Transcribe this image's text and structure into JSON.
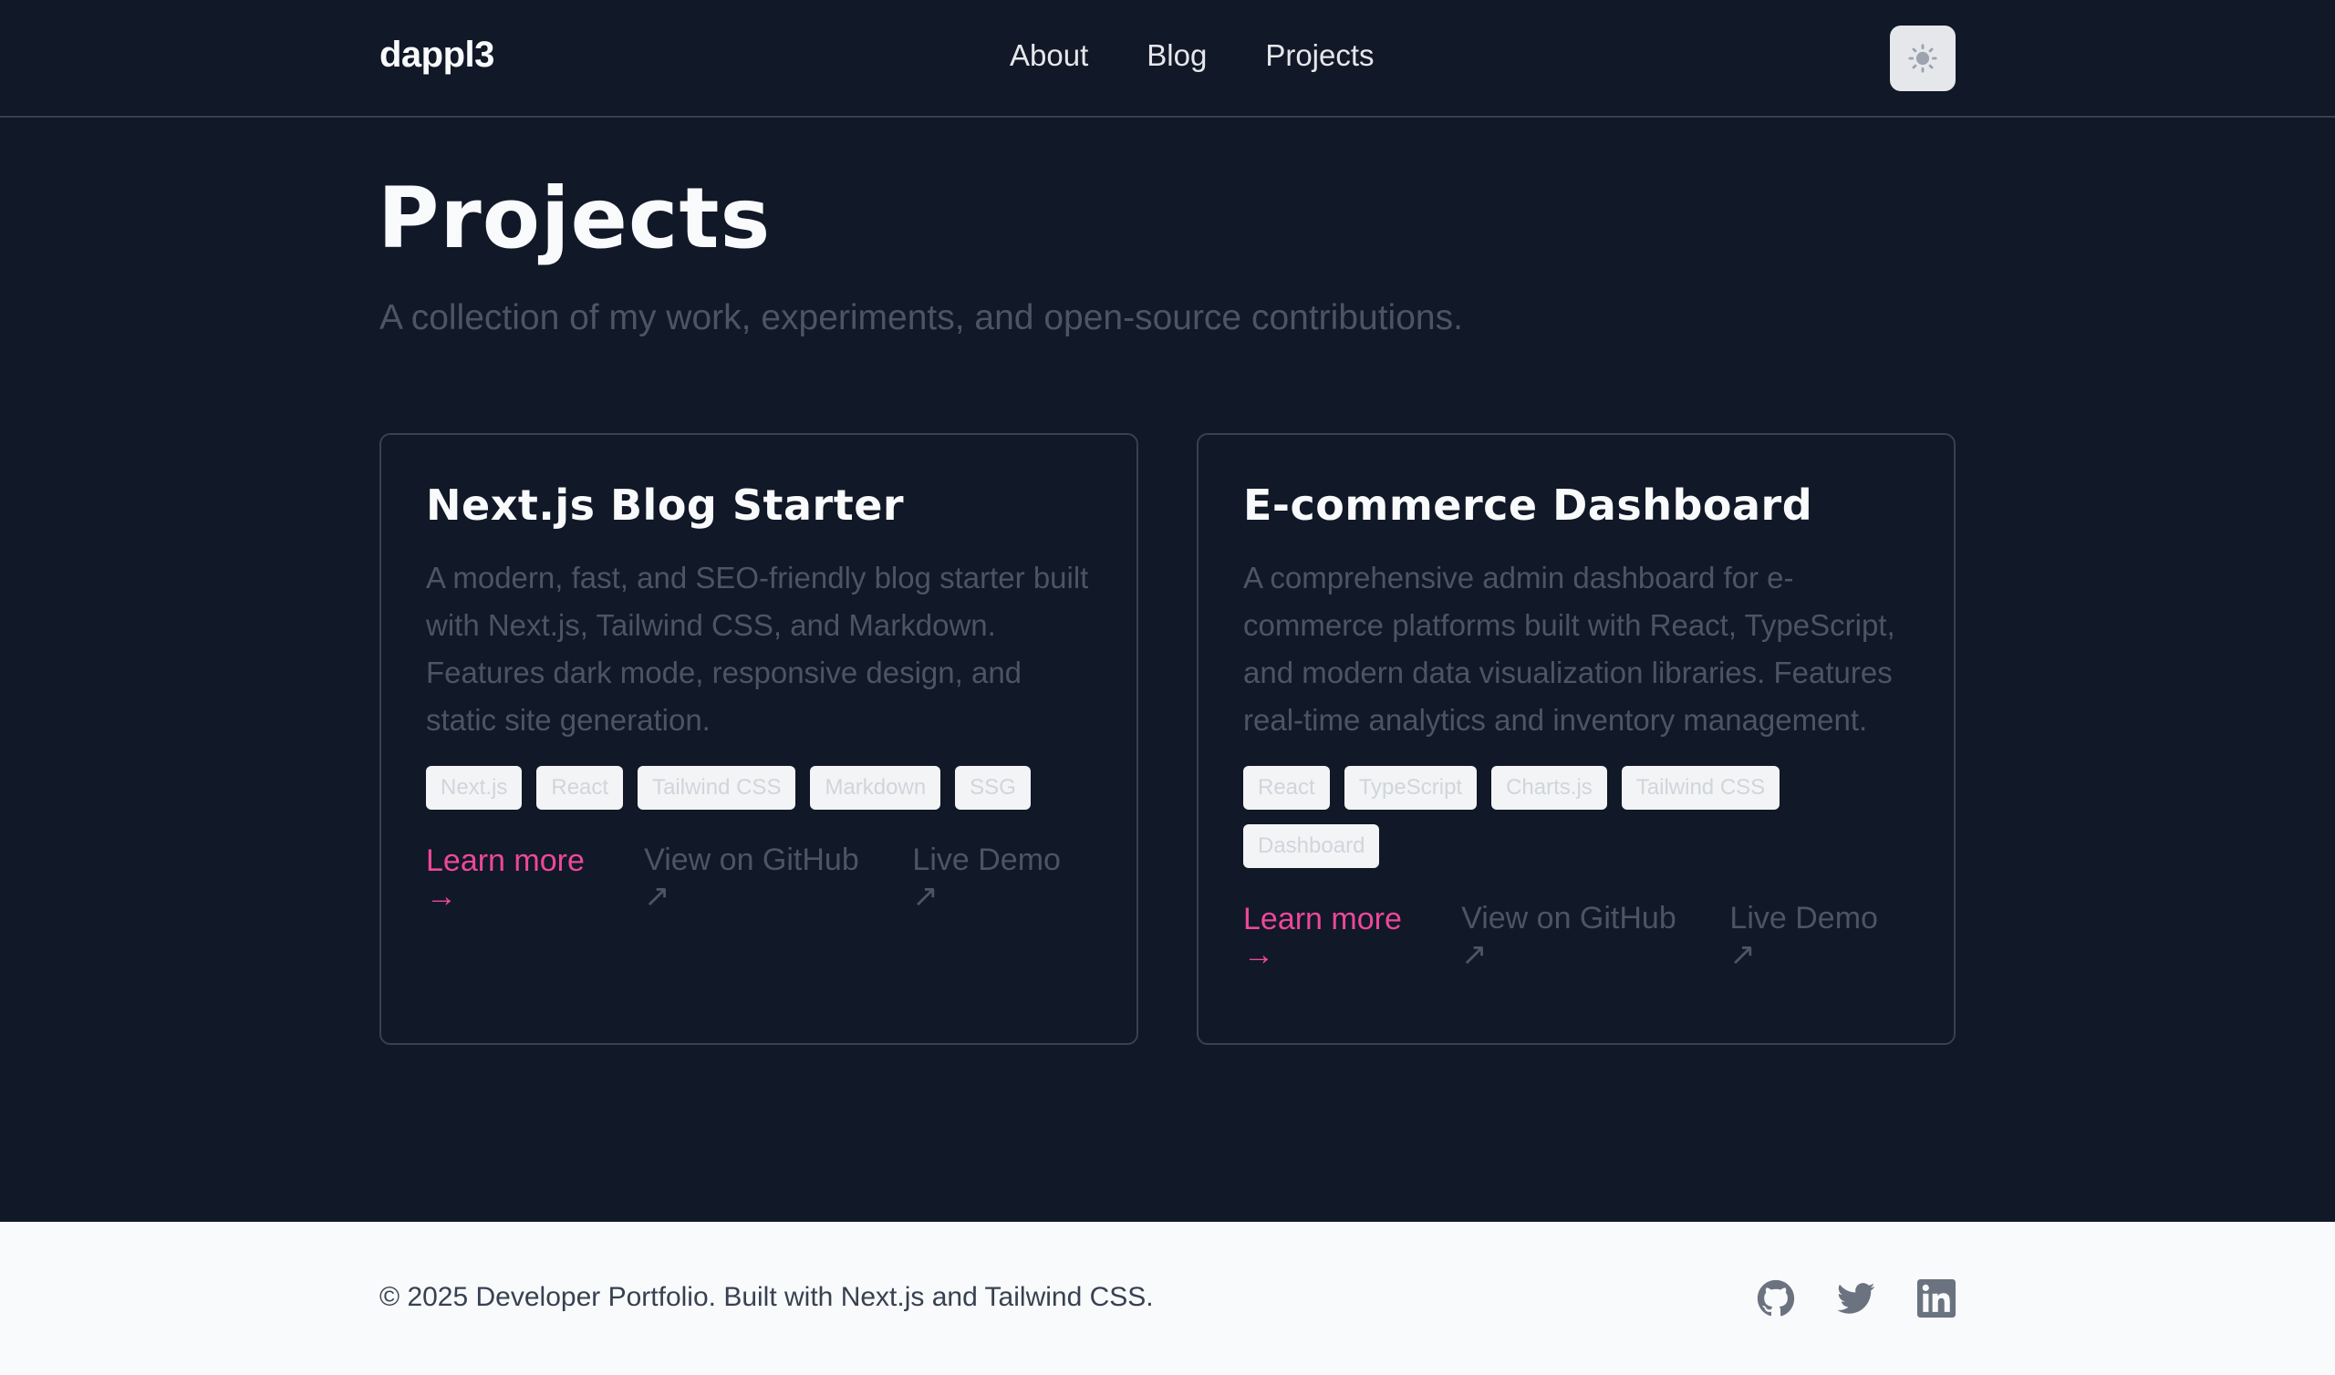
{
  "header": {
    "logo": "dappl3",
    "nav": [
      {
        "label": "About"
      },
      {
        "label": "Blog"
      },
      {
        "label": "Projects"
      }
    ],
    "theme_toggle_icon": "sun-icon"
  },
  "main": {
    "title": "Projects",
    "subtitle": "A collection of my work, experiments, and open-source contributions.",
    "projects": [
      {
        "title": "Next.js Blog Starter",
        "description": "A modern, fast, and SEO-friendly blog starter built with Next.js, Tailwind CSS, and Markdown. Features dark mode, responsive design, and static site generation.",
        "tags": [
          "Next.js",
          "React",
          "Tailwind CSS",
          "Markdown",
          "SSG"
        ],
        "learn_more": "Learn more →",
        "github": "View on GitHub ↗",
        "demo": "Live Demo ↗"
      },
      {
        "title": "E-commerce Dashboard",
        "description": "A comprehensive admin dashboard for e-commerce platforms built with React, TypeScript, and modern data visualization libraries. Features real-time analytics and inventory management.",
        "tags": [
          "React",
          "TypeScript",
          "Charts.js",
          "Tailwind CSS",
          "Dashboard"
        ],
        "learn_more": "Learn more →",
        "github": "View on GitHub ↗",
        "demo": "Live Demo ↗"
      }
    ]
  },
  "footer": {
    "copyright": "© 2025 Developer Portfolio. Built with Next.js and Tailwind CSS.",
    "socials": [
      "github-icon",
      "twitter-icon",
      "linkedin-icon"
    ]
  },
  "colors": {
    "background": "#111827",
    "accent": "#ec4899",
    "muted_text": "#4b5563",
    "footer_bg": "#f9fafb"
  }
}
